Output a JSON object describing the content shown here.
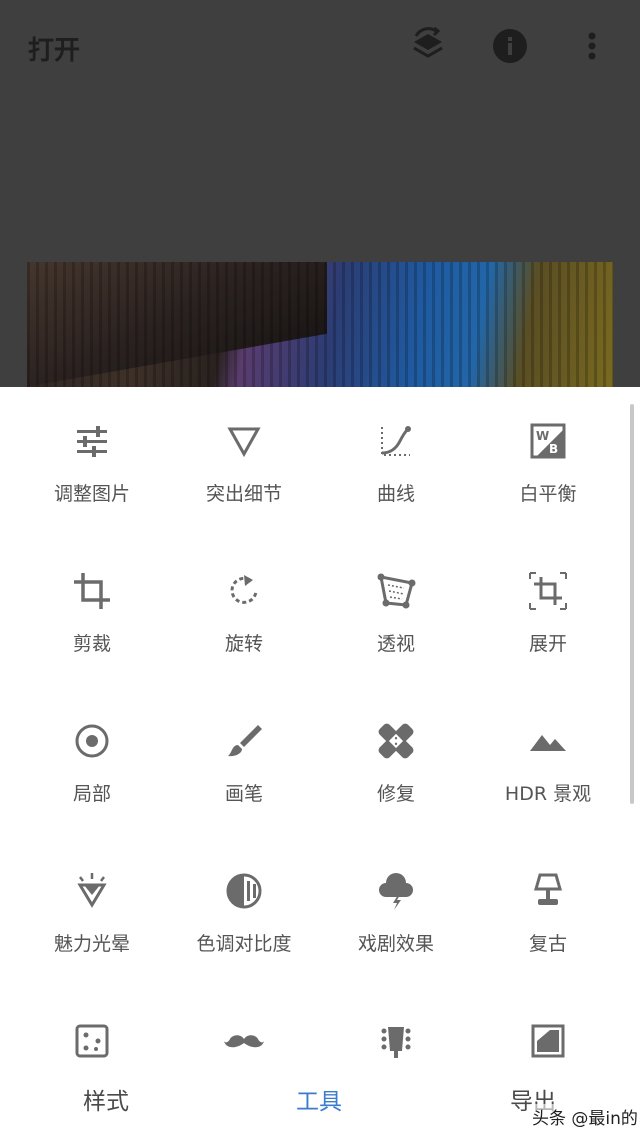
{
  "header": {
    "title": "打开"
  },
  "tools": [
    {
      "label": "调整图片",
      "icon": "tune-sliders-icon"
    },
    {
      "label": "突出细节",
      "icon": "triangle-icon"
    },
    {
      "label": "曲线",
      "icon": "curve-icon"
    },
    {
      "label": "白平衡",
      "icon": "white-balance-icon"
    },
    {
      "label": "剪裁",
      "icon": "crop-icon"
    },
    {
      "label": "旋转",
      "icon": "rotate-icon"
    },
    {
      "label": "透视",
      "icon": "perspective-icon"
    },
    {
      "label": "展开",
      "icon": "expand-icon"
    },
    {
      "label": "局部",
      "icon": "selective-icon"
    },
    {
      "label": "画笔",
      "icon": "brush-icon"
    },
    {
      "label": "修复",
      "icon": "healing-bandage-icon"
    },
    {
      "label": "HDR 景观",
      "icon": "mountains-icon"
    },
    {
      "label": "魅力光晕",
      "icon": "diamond-icon"
    },
    {
      "label": "色调对比度",
      "icon": "contrast-icon"
    },
    {
      "label": "戏剧效果",
      "icon": "storm-cloud-icon"
    },
    {
      "label": "复古",
      "icon": "lamp-icon"
    },
    {
      "label": "",
      "icon": "dice-icon"
    },
    {
      "label": "",
      "icon": "mustache-icon"
    },
    {
      "label": "",
      "icon": "guitar-head-icon"
    },
    {
      "label": "",
      "icon": "frame-icon"
    }
  ],
  "bottom_nav": {
    "styles": "样式",
    "tools": "工具",
    "export": "导出"
  },
  "watermark": "头条 @最in的",
  "colors": {
    "accent": "#3b7ccf",
    "icon": "#6b6b6b",
    "overlay": "#3f3f3f"
  }
}
